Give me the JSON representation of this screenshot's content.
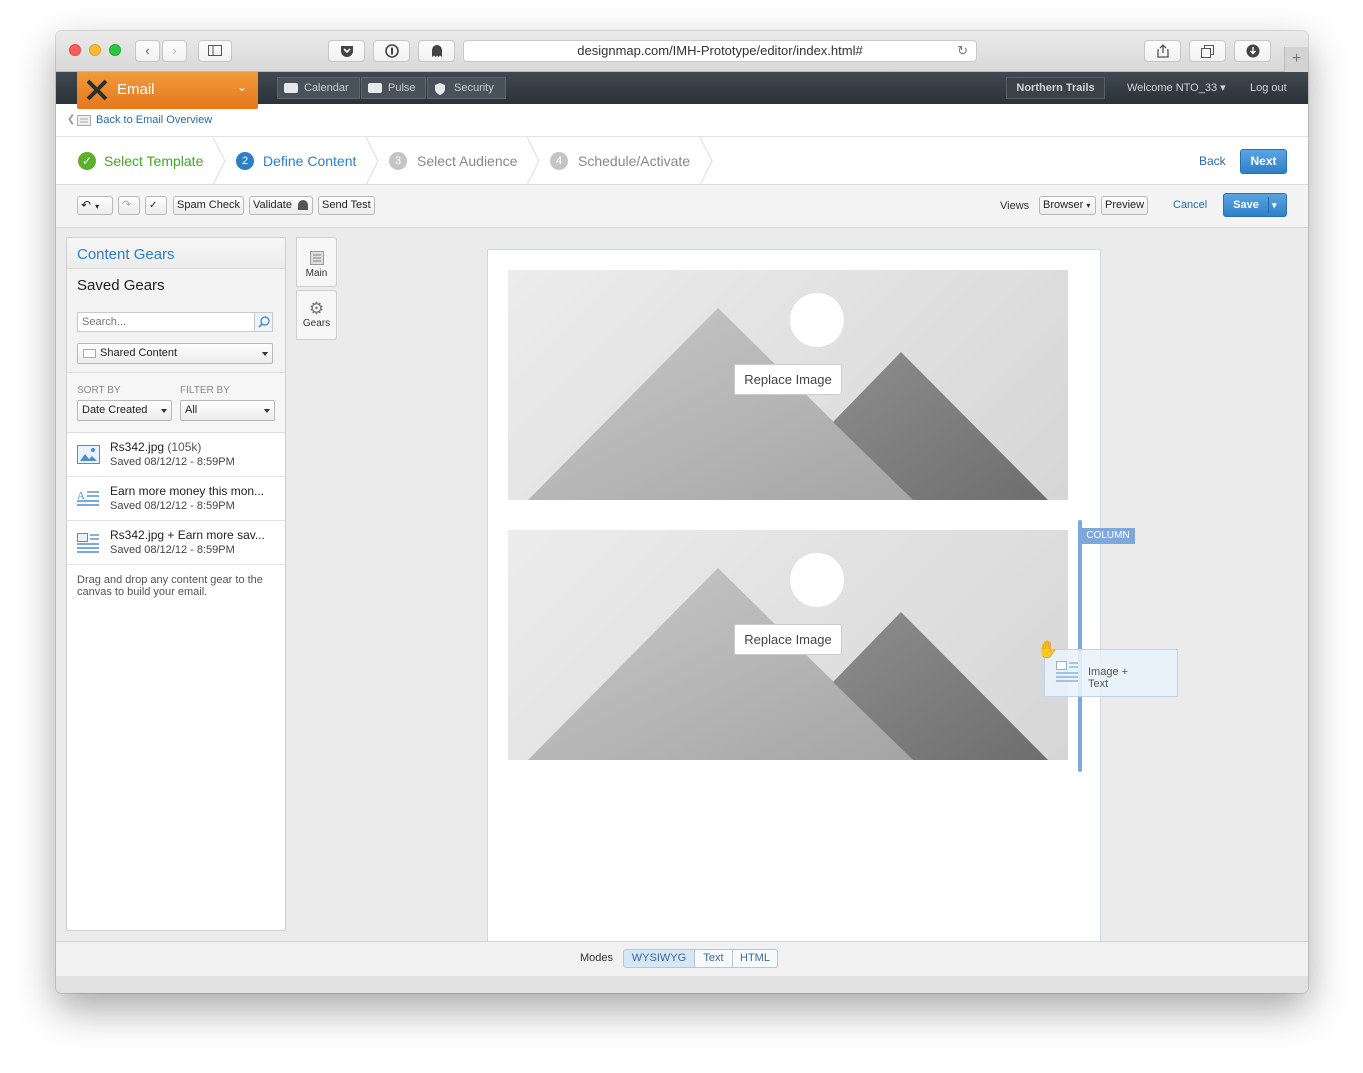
{
  "browser": {
    "url": "designmap.com/IMH-Prototype/editor/index.html#"
  },
  "app": {
    "name": "Email",
    "nav_tabs": [
      {
        "label": "Calendar"
      },
      {
        "label": "Pulse"
      },
      {
        "label": "Security"
      }
    ],
    "org_button": "Northern Trails",
    "welcome": "Welcome NTO_33",
    "logout": "Log out"
  },
  "breadcrumb": {
    "back_label": "Back to Email Overview"
  },
  "steps": [
    {
      "num": "✓",
      "label": "Select Template",
      "state": "done"
    },
    {
      "num": "2",
      "label": "Define Content",
      "state": "active"
    },
    {
      "num": "3",
      "label": "Select Audience",
      "state": "pending"
    },
    {
      "num": "4",
      "label": "Schedule/Activate",
      "state": "pending"
    }
  ],
  "step_actions": {
    "back": "Back",
    "next": "Next"
  },
  "toolbar": {
    "spam_check": "Spam Check",
    "validate": "Validate",
    "send_test": "Send Test",
    "views_label": "Views",
    "views_select": "Browser",
    "preview": "Preview",
    "cancel": "Cancel",
    "save": "Save"
  },
  "left_panel": {
    "title": "Content Gears",
    "subtitle": "Saved Gears",
    "search_placeholder": "Search...",
    "folder_select": "Shared Content",
    "sort_by_label": "SORT BY",
    "filter_by_label": "FILTER BY",
    "sort_value": "Date Created",
    "filter_value": "All",
    "items": [
      {
        "icon": "image-icon",
        "title": "Rs342.jpg",
        "size": "(105k)",
        "saved": "Saved 08/12/12 - 8:59PM"
      },
      {
        "icon": "text-icon",
        "title": "Earn more money this mon...",
        "size": "",
        "saved": "Saved 08/12/12 - 8:59PM"
      },
      {
        "icon": "image-text-icon",
        "title": "Rs342.jpg + Earn more sav...",
        "size": "",
        "saved": "Saved 08/12/12 - 8:59PM"
      }
    ],
    "hint": "Drag and drop any content gear to the canvas to build your email."
  },
  "side_tabs": [
    {
      "label": "Main",
      "icon": "list-icon"
    },
    {
      "label": "Gears",
      "icon": "gear-icon"
    }
  ],
  "canvas": {
    "replace_label": "Replace Image",
    "column_label": "COLUMN",
    "drag_item_label_line1": "Image +",
    "drag_item_label_line2": "Text"
  },
  "modes": {
    "label": "Modes",
    "options": [
      "WYSIWYG",
      "Text",
      "HTML"
    ],
    "active": "WYSIWYG"
  },
  "colors": {
    "accent_blue": "#2d7ec3",
    "success_green": "#5cb02a",
    "brand_orange": "#e8831f",
    "column_blue": "#7da8dc"
  }
}
